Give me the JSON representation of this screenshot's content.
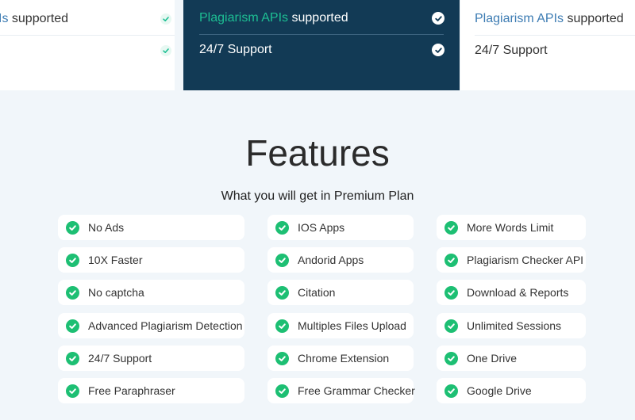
{
  "pricing": {
    "left": {
      "row1_highlight": "Is",
      "row1_rest": " supported"
    },
    "middle": {
      "row1_highlight": "Plagiarism APIs",
      "row1_rest": " supported",
      "row2": "24/7 Support"
    },
    "right": {
      "row1_highlight": "Plagiarism APIs",
      "row1_rest": " supported",
      "row2": "24/7 Support"
    }
  },
  "features": {
    "title": "Features",
    "subtitle": "What you will get in Premium Plan",
    "column1": [
      "No Ads",
      "10X Faster",
      "No captcha",
      "Advanced Plagiarism Detection",
      "24/7 Support",
      "Free Paraphraser"
    ],
    "column2": [
      "IOS Apps",
      "Andorid Apps",
      "Citation",
      "Multiples Files Upload",
      "Chrome Extension",
      "Free Grammar Checker"
    ],
    "column3": [
      "More Words Limit",
      "Plagiarism Checker API",
      "Download & Reports",
      "Unlimited Sessions",
      "One Drive",
      "Google Drive"
    ]
  },
  "colors": {
    "accent_green": "#1dbf73",
    "dark_panel": "#123a55",
    "highlight_blue": "#3d7cb3",
    "highlight_teal": "#1dbf93"
  }
}
